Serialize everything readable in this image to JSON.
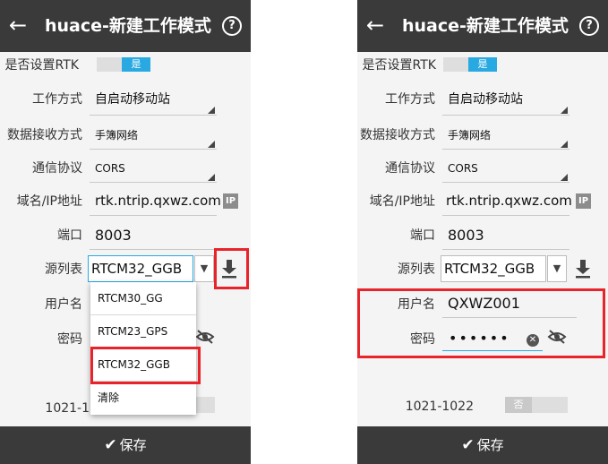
{
  "header": {
    "title": "huace-新建工作模式",
    "help": "?"
  },
  "form": {
    "rtk_label": "是否设置RTK",
    "rtk_on": "是",
    "work_mode_label": "工作方式",
    "work_mode_value": "自启动移动站",
    "data_recv_label": "数据接收方式",
    "data_recv_value": "手簿网络",
    "protocol_label": "通信协议",
    "protocol_value": "CORS",
    "domain_label": "域名/IP地址",
    "domain_value": "rtk.ntrip.qxwz.com",
    "ip_badge": "IP",
    "port_label": "端口",
    "port_value": "8003",
    "source_label": "源列表",
    "source_value": "RTCM32_GGB",
    "source_arrow": "▼",
    "username_label": "用户名",
    "password_label": "密码",
    "freq_label": "1021-1022",
    "freq_off": "否"
  },
  "left_screen": {
    "dropdown_options": [
      "RTCM30_GG",
      "RTCM23_GPS",
      "RTCM32_GGB",
      "清除"
    ],
    "freq_label_partial": "1021-1"
  },
  "right_screen": {
    "username_value": "QXWZ001",
    "password_value": "••••••"
  },
  "footer": {
    "save_label": "保存",
    "save_icon": "check-icon"
  },
  "colors": {
    "bar": "#3a3a3a",
    "accent": "#29a9e1",
    "highlight": "#e8232a"
  }
}
